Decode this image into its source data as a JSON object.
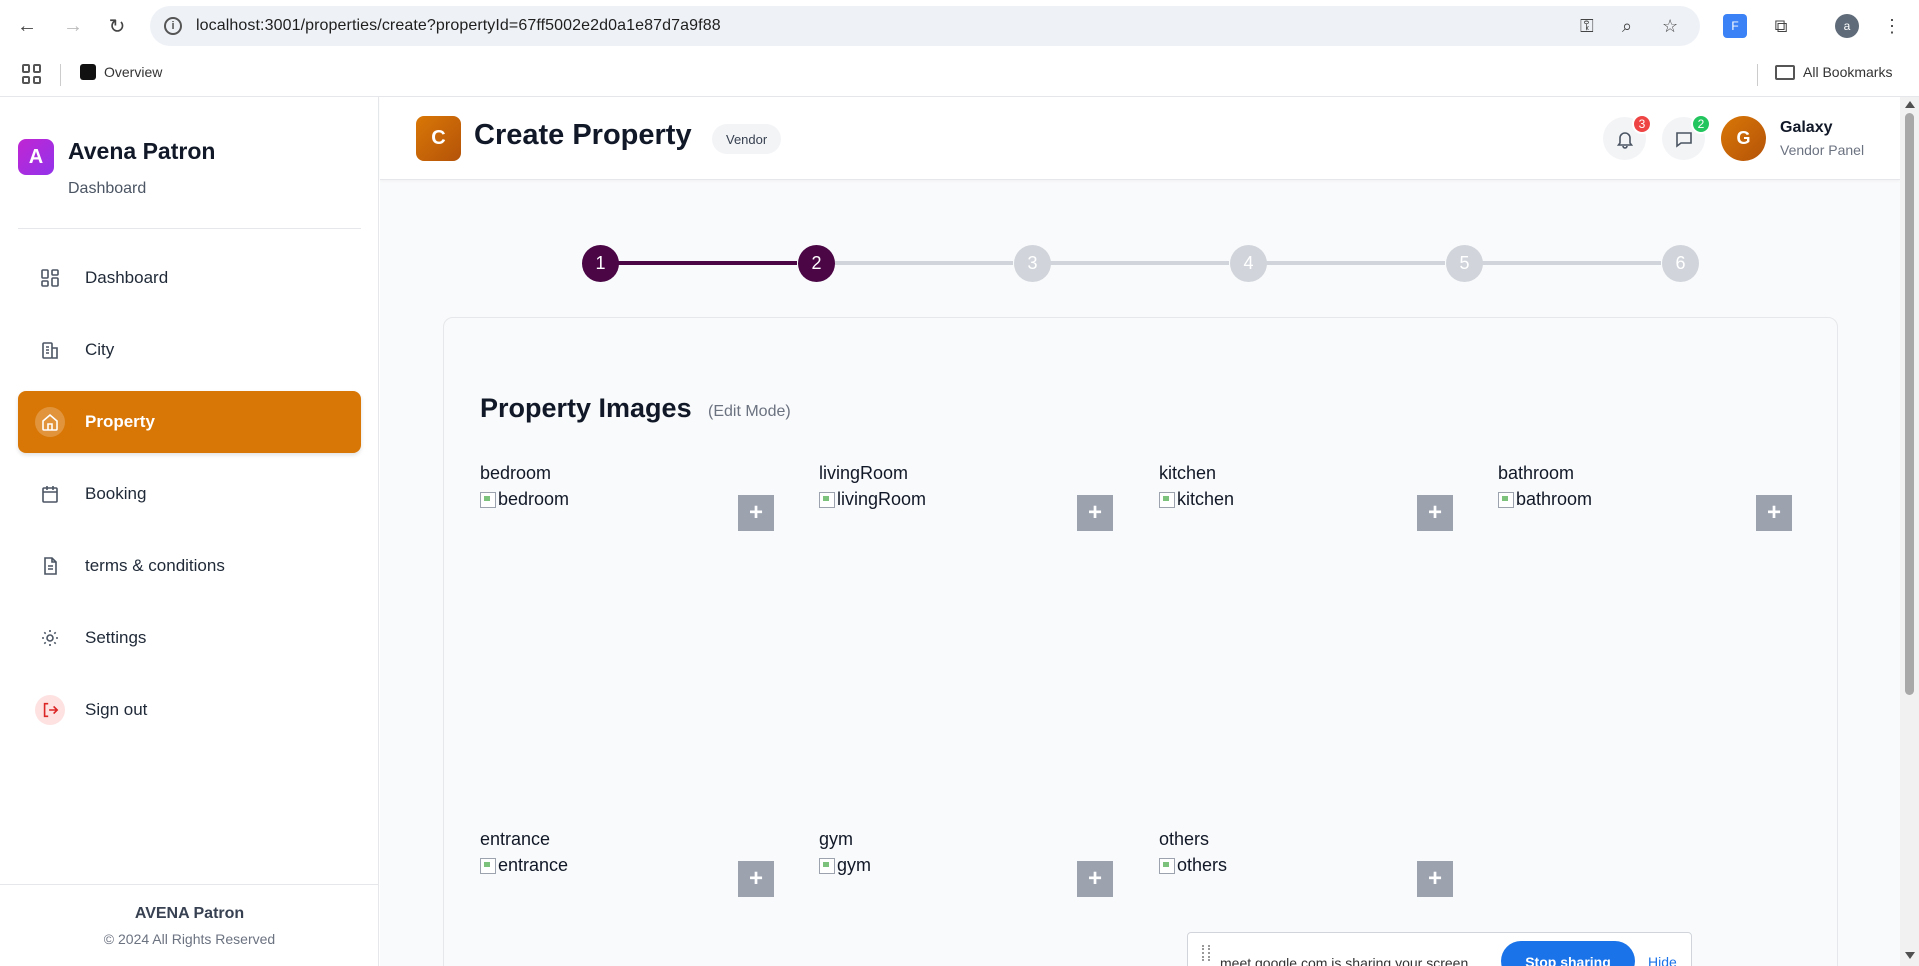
{
  "browser": {
    "url": "localhost:3001/properties/create?propertyId=67ff5002e2d0a1e87d7a9f88",
    "profile_initial": "a",
    "bookmarks": {
      "overview": "Overview",
      "all": "All Bookmarks"
    }
  },
  "sidebar": {
    "brand_initial": "A",
    "brand_name": "Avena Patron",
    "brand_sub": "Dashboard",
    "items": [
      {
        "label": "Dashboard",
        "icon": "dashboard-icon"
      },
      {
        "label": "City",
        "icon": "building-icon"
      },
      {
        "label": "Property",
        "icon": "home-icon",
        "active": true
      },
      {
        "label": "Booking",
        "icon": "calendar-icon"
      },
      {
        "label": "terms & conditions",
        "icon": "document-icon"
      },
      {
        "label": "Settings",
        "icon": "gear-icon"
      },
      {
        "label": "Sign out",
        "icon": "sign-out-icon"
      }
    ],
    "footer_title": "AVENA Patron",
    "footer_copy": "© 2024 All Rights Reserved"
  },
  "header": {
    "page_initial": "C",
    "title": "Create Property",
    "role_pill": "Vendor",
    "notifications_count": "3",
    "messages_count": "2",
    "user_initial": "G",
    "user_name": "Galaxy",
    "user_role": "Vendor Panel"
  },
  "stepper": {
    "steps": [
      "1",
      "2",
      "3",
      "4",
      "5",
      "6"
    ],
    "current": 2
  },
  "images_section": {
    "title": "Property Images",
    "mode": "(Edit Mode)",
    "tiles": [
      {
        "label": "bedroom",
        "alt": "bedroom"
      },
      {
        "label": "livingRoom",
        "alt": "livingRoom"
      },
      {
        "label": "kitchen",
        "alt": "kitchen"
      },
      {
        "label": "bathroom",
        "alt": "bathroom"
      },
      {
        "label": "entrance",
        "alt": "entrance"
      },
      {
        "label": "gym",
        "alt": "gym"
      },
      {
        "label": "others",
        "alt": "others"
      }
    ],
    "add_symbol": "+"
  },
  "sharebar": {
    "text": "meet.google.com is sharing your screen.",
    "stop": "Stop sharing",
    "hide": "Hide"
  },
  "colors": {
    "accent": "#d97706",
    "step_done": "#4a0645",
    "step_todo": "#d1d5db",
    "notif_badge": "#ef4444",
    "msg_badge": "#22c55e"
  }
}
